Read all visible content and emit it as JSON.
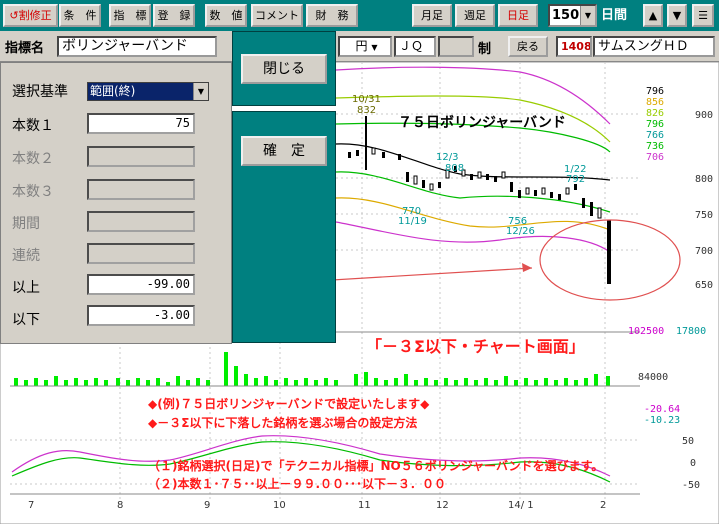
{
  "toolbar": {
    "buttons": [
      "↺割修正",
      "条　件",
      "指　標",
      "登　録",
      "数　値",
      "コメント",
      "財　務"
    ],
    "periods": [
      "月足",
      "週足",
      "日足"
    ],
    "count": "150",
    "days_label": "日間",
    "colors": {
      "teal": "#008080",
      "active_period": "#d40000"
    }
  },
  "row2": {
    "indicator_label": "指標名",
    "indicator_value": "ボリンジャーバンド",
    "currency": "円",
    "market": "ＪＱ",
    "system_label": "制",
    "back_button": "戻る",
    "code": "1408",
    "company": "サムスングＨＤ"
  },
  "panel": {
    "criteria_label": "選択基準",
    "criteria_value": "範囲(終)",
    "count1_label": "本数１",
    "count1_value": "75",
    "count2_label": "本数２",
    "count3_label": "本数３",
    "period_label": "期間",
    "continuous_label": "連続",
    "above_label": "以上",
    "above_value": "-99.00",
    "below_label": "以下",
    "below_value": "-3.00",
    "close_button": "閉じる",
    "confirm_button": "確　定"
  },
  "chart": {
    "title": "７５日ボリンジャーバンド",
    "right_axis_price": [
      "900",
      "850",
      "800",
      "750",
      "700",
      "650"
    ],
    "legend_values": [
      "796",
      "856",
      "826",
      "796",
      "766",
      "736",
      "706"
    ],
    "volume_axis": [
      "102500",
      "84000"
    ],
    "volume_side": "17800",
    "oscillator_axis": [
      "-20.64",
      "-10.23",
      "50",
      "0",
      "-50"
    ],
    "annotations": [
      {
        "label": "10/31",
        "value": "832"
      },
      {
        "label": "12/3",
        "value": "808"
      },
      {
        "label": "1/22",
        "value": "792"
      },
      {
        "label": "770",
        "value": "11/19"
      },
      {
        "label": "756",
        "value": "12/26"
      }
    ],
    "x_dates": [
      "7",
      "8",
      "9",
      "10",
      "11",
      "12",
      "14/ 1",
      "2"
    ],
    "bracket_caption": "「－３Σ以下・チャート画面」",
    "notes": [
      "◆(例)７５日ボリンジャーバンドで設定いたします◆",
      "◆－３Σ以下に下落した銘柄を選ぶ場合の設定方法"
    ],
    "steps": [
      "（１)銘柄選択(日足)で「テクニカル指標」NO５６ボリンジャーバンドを選びます。",
      "（２)本数１･７５･･以上－９９.００･･･以下－３．００"
    ]
  },
  "chart_data": {
    "type": "line",
    "title": "７５日ボリンジャーバンド",
    "x": [
      "7",
      "8",
      "9",
      "10",
      "11",
      "12",
      "14/ 1",
      "2"
    ],
    "series": [
      {
        "values": [
          796,
          856,
          826,
          796,
          766,
          736,
          706
        ]
      }
    ],
    "ylim": [
      650,
      900
    ]
  }
}
